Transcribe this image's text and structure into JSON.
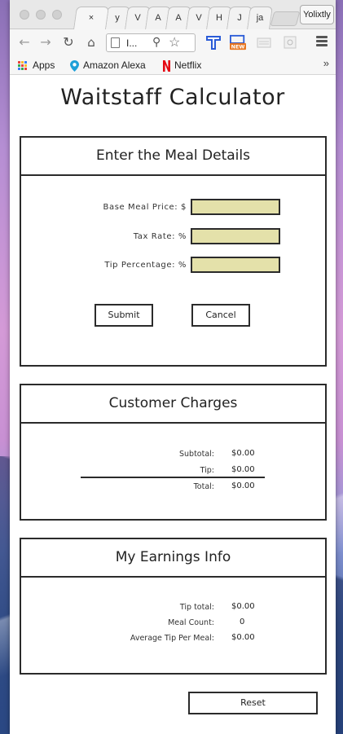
{
  "browser": {
    "tabs": [
      {
        "label": "×"
      },
      {
        "label": "y"
      },
      {
        "label": "V"
      },
      {
        "label": "A"
      },
      {
        "label": "A"
      },
      {
        "label": "V"
      },
      {
        "label": "H"
      },
      {
        "label": "J"
      },
      {
        "label": "ja"
      }
    ],
    "profile_name": "Yolixtly",
    "url_display": "I...",
    "bookmarks": [
      {
        "label": "Apps",
        "icon": "apps-grid-icon"
      },
      {
        "label": "Amazon Alexa",
        "icon": "alexa-location-icon"
      },
      {
        "label": "Netflix",
        "icon": "netflix-icon"
      }
    ],
    "overflow": "»"
  },
  "app": {
    "title": "Waitstaff Calculator",
    "meal_details": {
      "heading": "Enter the Meal Details",
      "base_price_label": "Base Meal Price: $",
      "tax_rate_label": "Tax Rate: %",
      "tip_percentage_label": "Tip Percentage: %",
      "base_price_value": "",
      "tax_rate_value": "",
      "tip_percentage_value": "",
      "submit_label": "Submit",
      "cancel_label": "Cancel"
    },
    "customer_charges": {
      "heading": "Customer Charges",
      "subtotal_label": "Subtotal:",
      "subtotal_value": "$0.00",
      "tip_label": "Tip:",
      "tip_value": "$0.00",
      "total_label": "Total:",
      "total_value": "$0.00"
    },
    "earnings": {
      "heading": "My Earnings Info",
      "tip_total_label": "Tip total:",
      "tip_total_value": "$0.00",
      "meal_count_label": "Meal Count:",
      "meal_count_value": "0",
      "avg_tip_label": "Average Tip Per Meal:",
      "avg_tip_value": "$0.00"
    },
    "reset_label": "Reset"
  },
  "colors": {
    "input_fill": "#e4e1aa",
    "border": "#2b2b2b",
    "netflix_red": "#e50914",
    "alexa_blue": "#1fa0d8"
  }
}
